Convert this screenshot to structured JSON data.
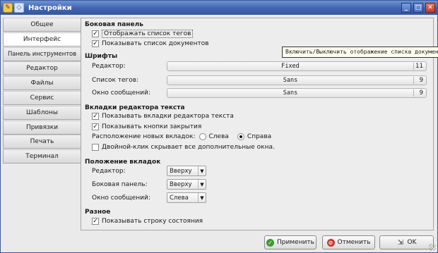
{
  "window": {
    "title": "Настройки"
  },
  "tabs": [
    {
      "label": "Общее"
    },
    {
      "label": "Интерфейс"
    },
    {
      "label": "Панель инструментов"
    },
    {
      "label": "Редактор"
    },
    {
      "label": "Файлы"
    },
    {
      "label": "Сервис"
    },
    {
      "label": "Шаблоны"
    },
    {
      "label": "Привязки"
    },
    {
      "label": "Печать"
    },
    {
      "label": "Терминал"
    }
  ],
  "sidebar": {
    "title": "Боковая панель",
    "show_tags": "Отображать список тегов",
    "show_docs": "Показывать список документов"
  },
  "tooltip": "Включить/Выключить отображение списка документов",
  "fonts": {
    "title": "Шрифты",
    "editor_label": "Редактор:",
    "editor_font": "Fixed",
    "editor_size": "11",
    "tags_label": "Список тегов:",
    "tags_font": "Sans",
    "tags_size": "9",
    "msg_label": "Окно сообщений:",
    "msg_font": "Sans",
    "msg_size": "9"
  },
  "editor_tabs": {
    "title": "Вкладки редактора текста",
    "show_tabs": "Показывать вкладки редактора текста",
    "show_close": "Показывать кнопки закрытия",
    "placement_label": "Расположение новых вкладок:",
    "left": "Слева",
    "right": "Справа",
    "dblclick": "Двойной-клик скрывает все дополнительные окна."
  },
  "tab_position": {
    "title": "Положение вкладок",
    "editor_label": "Редактор:",
    "editor_value": "Вверху",
    "sidebar_label": "Боковая панель:",
    "sidebar_value": "Вверху",
    "msg_label": "Окно сообщений:",
    "msg_value": "Слева"
  },
  "misc": {
    "title": "Разное",
    "statusbar": "Показывать строку состояния"
  },
  "buttons": {
    "apply": "Применить",
    "cancel": "Отменить",
    "ok": "OK"
  }
}
